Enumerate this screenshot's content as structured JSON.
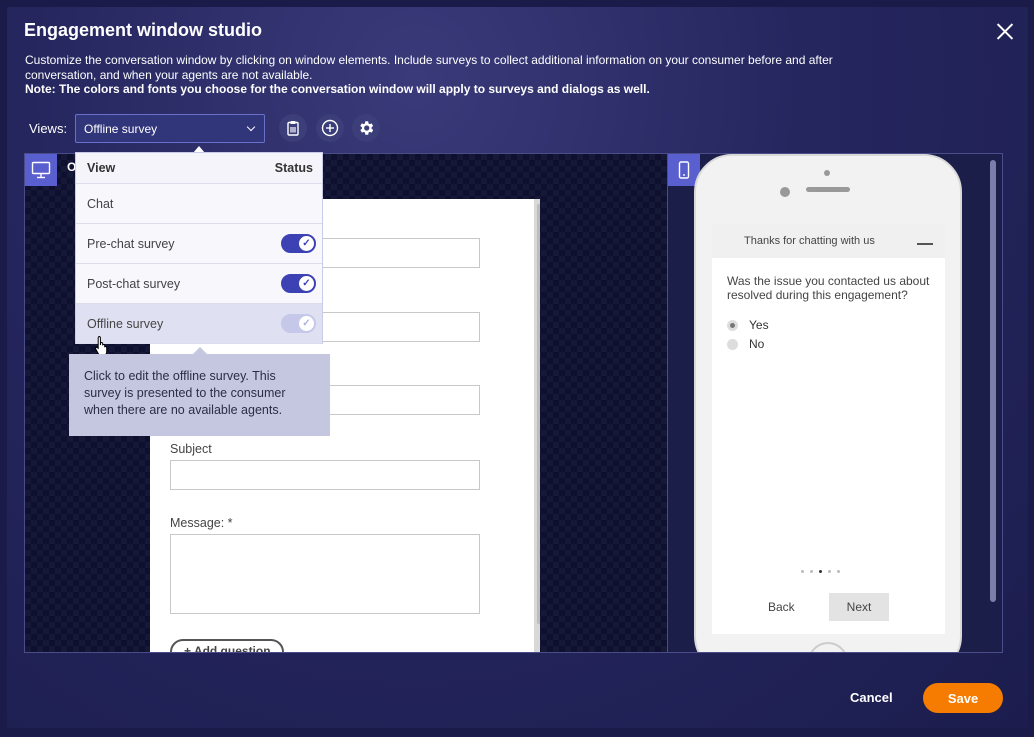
{
  "title": "Engagement window studio",
  "description": {
    "line1": "Customize the conversation window by clicking on window elements. Include surveys to collect additional information on your consumer before and after conversation, and when your agents are not available.",
    "note": "Note: The colors and fonts you choose for the conversation window will apply to surveys and dialogs as well."
  },
  "views": {
    "label": "Views:",
    "selected": "Offline survey"
  },
  "toolbar": {
    "delete_icon": "clipboard-icon",
    "add_icon": "plus-circle-icon",
    "settings_icon": "gear-icon"
  },
  "dropdown": {
    "header_view": "View",
    "header_status": "Status",
    "items": [
      {
        "label": "Chat",
        "toggle": null
      },
      {
        "label": "Pre-chat survey",
        "toggle": "on"
      },
      {
        "label": "Post-chat survey",
        "toggle": "on"
      },
      {
        "label": "Offline survey",
        "toggle": "on-disabled"
      }
    ]
  },
  "tooltip": {
    "text": "Click to edit the offline survey. This survey is presented to the consumer when there are no available agents."
  },
  "form": {
    "partial_label": "O",
    "subject_label": "Subject",
    "message_label": "Message: *",
    "add_question": "+ Add question"
  },
  "phone": {
    "header": "Thanks for chatting with us",
    "question": "Was the issue you contacted us about resolved during this engagement?",
    "options": [
      "Yes",
      "No"
    ],
    "selected_option": "Yes",
    "back": "Back",
    "next": "Next",
    "page_dots": 5,
    "current_page": 3
  },
  "footer": {
    "cancel": "Cancel",
    "save": "Save"
  },
  "colors": {
    "accent": "#5a5fcf",
    "save": "#f57c00"
  }
}
